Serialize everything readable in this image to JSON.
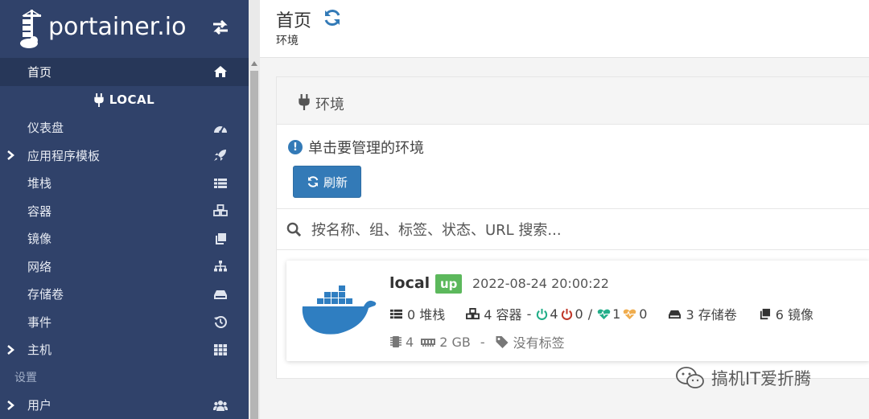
{
  "logo": {
    "text": "portainer.io"
  },
  "sidebar": {
    "home": "首页",
    "endpoint": "LOCAL",
    "items": [
      {
        "label": "仪表盘",
        "icon": "tachometer-icon"
      },
      {
        "label": "应用程序模板",
        "icon": "rocket-icon",
        "expandable": true
      },
      {
        "label": "堆栈",
        "icon": "list-icon"
      },
      {
        "label": "容器",
        "icon": "cubes-icon"
      },
      {
        "label": "镜像",
        "icon": "clone-icon"
      },
      {
        "label": "网络",
        "icon": "sitemap-icon"
      },
      {
        "label": "存储卷",
        "icon": "hdd-icon"
      },
      {
        "label": "事件",
        "icon": "history-icon"
      },
      {
        "label": "主机",
        "icon": "th-icon",
        "expandable": true
      }
    ],
    "section_settings": "设置",
    "users": "用户"
  },
  "header": {
    "title": "首页",
    "breadcrumb": "环境"
  },
  "panel": {
    "title": "环境",
    "hint": "单击要管理的环境",
    "refresh_label": "刷新",
    "search_placeholder": "按名称、组、标签、状态、URL 搜索..."
  },
  "environment": {
    "name": "local",
    "status": "up",
    "timestamp": "2022-08-24 20:00:22",
    "stacks": "0 堆栈",
    "containers": "4 容器",
    "dash": "-",
    "running": "4",
    "stopped": "0",
    "slash": "/",
    "healthy": "1",
    "unhealthy": "0",
    "volumes": "3 存储卷",
    "images": "6 镜像",
    "cpu": "4",
    "memory": "2 GB",
    "dash2": "-",
    "tags": "没有标签"
  },
  "watermark": {
    "text": "搞机IT爱折腾"
  },
  "colors": {
    "sidebar": "#30426a",
    "primary": "#337ab7",
    "up": "#5cb85c",
    "docker": "#2f7ec1"
  }
}
